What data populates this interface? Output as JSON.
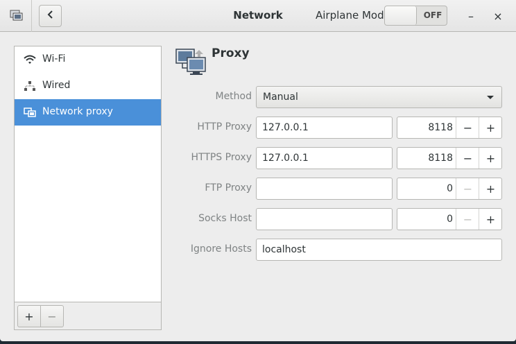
{
  "header": {
    "title": "Network",
    "airplane_label": "Airplane Mode",
    "airplane_state": "OFF",
    "minimize_icon": "–",
    "close_icon": "×"
  },
  "sidebar": {
    "items": [
      {
        "label": "Wi-Fi",
        "icon": "wifi-icon"
      },
      {
        "label": "Wired",
        "icon": "wired-icon"
      },
      {
        "label": "Network proxy",
        "icon": "network-proxy-icon",
        "selected": true
      }
    ],
    "add_label": "+",
    "remove_label": "−"
  },
  "proxy": {
    "title": "Proxy",
    "method_label": "Method",
    "method_value": "Manual",
    "http_label": "HTTP Proxy",
    "http_host": "127.0.0.1",
    "http_port": "8118",
    "https_label": "HTTPS Proxy",
    "https_host": "127.0.0.1",
    "https_port": "8118",
    "ftp_label": "FTP Proxy",
    "ftp_host": "",
    "ftp_port": "0",
    "socks_label": "Socks Host",
    "socks_host": "",
    "socks_port": "0",
    "ignore_label": "Ignore Hosts",
    "ignore_value": "localhost",
    "minus_symbol": "−",
    "plus_symbol": "+"
  },
  "colors": {
    "accent": "#4a90d9",
    "window_bg": "#ededed",
    "label_gray": "#7f8384"
  }
}
